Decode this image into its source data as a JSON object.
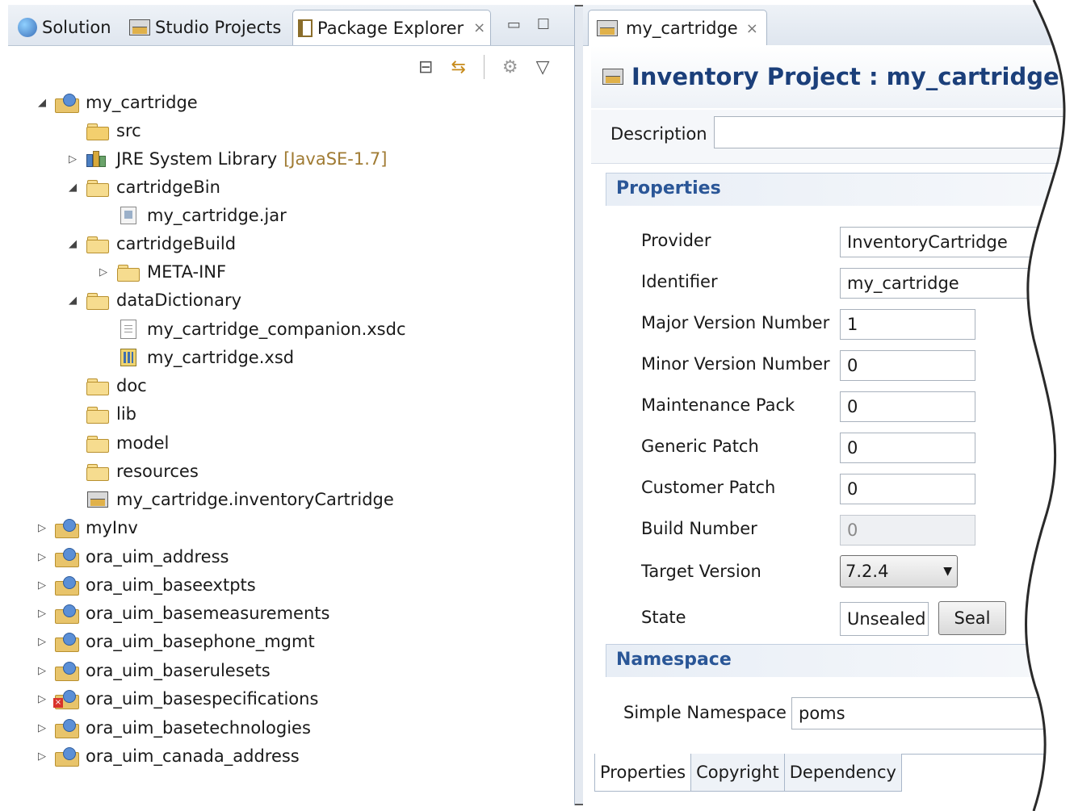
{
  "left_tabs": [
    {
      "label": "Solution"
    },
    {
      "label": "Studio Projects"
    },
    {
      "label": "Package Explorer"
    }
  ],
  "icons": {
    "close": "×",
    "minimize": "▭",
    "maximize": "☐",
    "collapse_all": "⊟",
    "link_with_editor": "⇆",
    "filter": "⚙",
    "view_menu": "▽",
    "expanded": "◢",
    "collapsed": "▷",
    "dropdown": "▼"
  },
  "tree": {
    "my_cartridge": "my_cartridge",
    "src": "src",
    "jre_name": "JRE System Library",
    "jre_version": "[JavaSE-1.7]",
    "cartridgeBin": "cartridgeBin",
    "cartridge_jar": "my_cartridge.jar",
    "cartridgeBuild": "cartridgeBuild",
    "meta_inf": "META-INF",
    "dataDictionary": "dataDictionary",
    "companion_xsdc": "my_cartridge_companion.xsdc",
    "cartridge_xsd": "my_cartridge.xsd",
    "doc": "doc",
    "lib": "lib",
    "model": "model",
    "resources": "resources",
    "inventory_cartridge": "my_cartridge.inventoryCartridge",
    "projects": [
      "myInv",
      "ora_uim_address",
      "ora_uim_baseextpts",
      "ora_uim_basemeasurements",
      "ora_uim_basephone_mgmt",
      "ora_uim_baserulesets",
      "ora_uim_basespecifications",
      "ora_uim_basetechnologies",
      "ora_uim_canada_address"
    ]
  },
  "editor": {
    "tab_label": "my_cartridge",
    "title": "Inventory Project : my_cartridge",
    "description_label": "Description",
    "description_value": "",
    "properties_section": "Properties",
    "provider_label": "Provider",
    "provider_value": "InventoryCartridge",
    "identifier_label": "Identifier",
    "identifier_value": "my_cartridge",
    "major_label": "Major Version Number",
    "major_value": "1",
    "minor_label": "Minor Version Number",
    "minor_value": "0",
    "maintenance_label": "Maintenance Pack",
    "maintenance_value": "0",
    "generic_label": "Generic Patch",
    "generic_value": "0",
    "customer_label": "Customer Patch",
    "customer_value": "0",
    "build_label": "Build Number",
    "build_value": "0",
    "target_label": "Target Version",
    "target_value": "7.2.4",
    "state_label": "State",
    "state_value": "Unsealed",
    "seal_button": "Seal",
    "namespace_section": "Namespace",
    "simple_namespace_label": "Simple Namespace",
    "simple_namespace_value": "poms",
    "bottom_tabs": [
      "Properties",
      "Copyright",
      "Dependency"
    ]
  },
  "colors": {
    "title_blue": "#1b3f7a",
    "section_blue": "#2a5697",
    "jre_tag": "#a07b33"
  }
}
